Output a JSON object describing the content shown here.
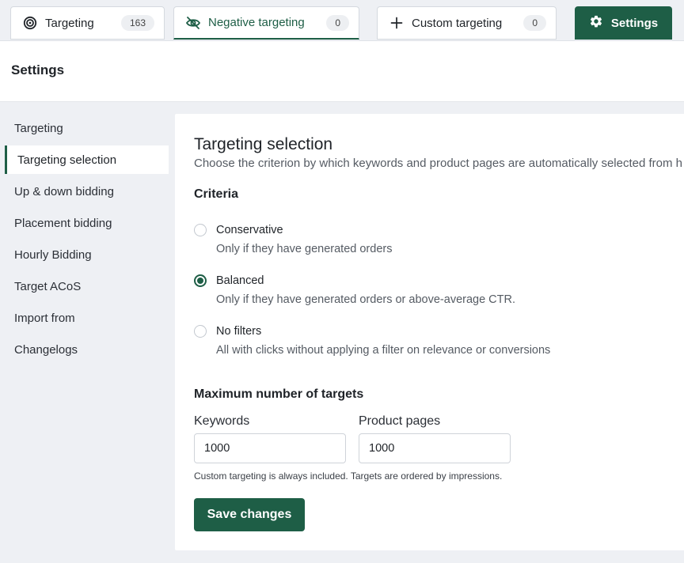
{
  "tabs": [
    {
      "icon": "target-icon",
      "label": "Targeting",
      "count": "163"
    },
    {
      "icon": "eye-off-icon",
      "label": "Negative targeting",
      "count": "0"
    },
    {
      "icon": "plus-icon",
      "label": "Custom targeting",
      "count": "0"
    }
  ],
  "settings_tab": {
    "icon": "gear-icon",
    "label": "Settings"
  },
  "page": {
    "title": "Settings"
  },
  "sidebar": {
    "items": [
      {
        "label": "Targeting"
      },
      {
        "label": "Targeting selection"
      },
      {
        "label": "Up & down bidding"
      },
      {
        "label": "Placement bidding"
      },
      {
        "label": "Hourly Bidding"
      },
      {
        "label": "Target ACoS"
      },
      {
        "label": "Import from"
      },
      {
        "label": "Changelogs"
      }
    ],
    "active": "Targeting selection"
  },
  "section": {
    "title": "Targeting selection",
    "description": "Choose the criterion by which keywords and product pages are automatically selected from h"
  },
  "criteria": {
    "title": "Criteria",
    "selected": "Balanced",
    "options": [
      {
        "label": "Conservative",
        "description": "Only if they have generated orders"
      },
      {
        "label": "Balanced",
        "description": "Only if they have generated orders or above-average CTR."
      },
      {
        "label": "No filters",
        "description": "All with clicks without applying a filter on relevance or conversions"
      }
    ]
  },
  "max_targets": {
    "title": "Maximum number of targets",
    "keywords_label": "Keywords",
    "keywords_value": "1000",
    "product_pages_label": "Product pages",
    "product_pages_value": "1000",
    "hint": "Custom targeting is always included. Targets are ordered by impressions."
  },
  "actions": {
    "save_label": "Save changes"
  },
  "colors": {
    "accent": "#1e5e46",
    "background": "#eef0f4",
    "panel": "#ffffff"
  }
}
